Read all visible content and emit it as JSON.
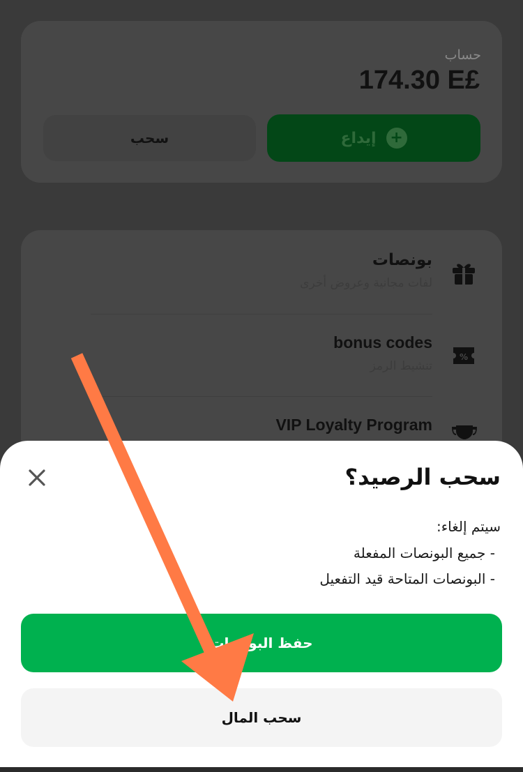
{
  "account": {
    "label": "حساب",
    "balance": "174.30 E£",
    "withdraw_label": "سحب",
    "deposit_label": "إيداع"
  },
  "menu": {
    "items": [
      {
        "title": "بونصات",
        "subtitle": "لفات مجانية وعروض أخرى",
        "icon": "gift-icon"
      },
      {
        "title": "bonus codes",
        "subtitle": "تنشيط الرمز",
        "icon": "ticket-icon"
      },
      {
        "title": "VIP Loyalty Program",
        "subtitle": "",
        "icon": "trophy-icon"
      }
    ]
  },
  "sheet": {
    "title": "سحب الرصيد؟",
    "note": "سيتم إلغاء:",
    "bullets": [
      "- جميع البونصات المفعلة",
      "- البونصات المتاحة قيد التفعيل"
    ],
    "save_label": "حفظ البونصات",
    "withdraw_cash_label": "سحب المال"
  },
  "colors": {
    "accent_green": "#00b14f",
    "annotation_arrow": "#ff7a45"
  }
}
